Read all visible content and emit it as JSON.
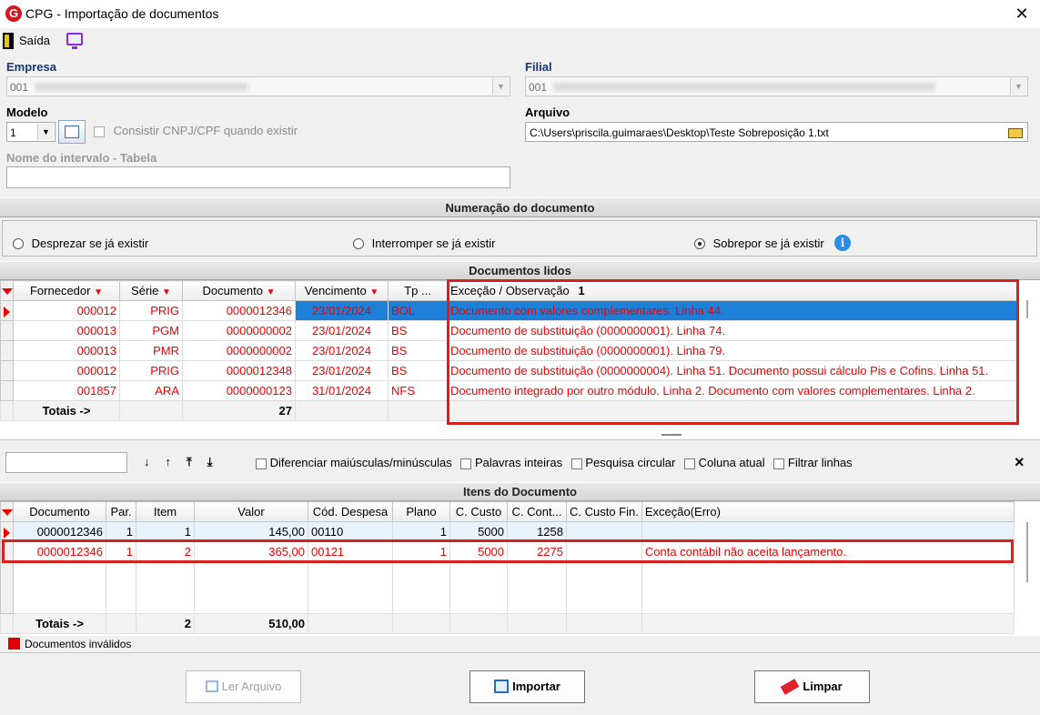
{
  "window": {
    "title": "CPG - Importação de documentos",
    "close": "✕"
  },
  "toolbar": {
    "exit_label": "Saída"
  },
  "empresa": {
    "label": "Empresa",
    "value": "001"
  },
  "filial": {
    "label": "Filial",
    "value": "001"
  },
  "modelo": {
    "label": "Modelo",
    "value": "1",
    "consistir_label": "Consistir CNPJ/CPF quando existir"
  },
  "arquivo": {
    "label": "Arquivo",
    "value": "C:\\Users\\priscila.guimaraes\\Desktop\\Teste Sobreposição 1.txt"
  },
  "intervalo": {
    "label": "Nome do intervalo - Tabela",
    "value": ""
  },
  "numeracao": {
    "title": "Numeração do documento",
    "options": [
      "Desprezar se já existir",
      "Interromper se já existir",
      "Sobrepor se já existir"
    ],
    "selected": "Sobrepor se já existir"
  },
  "docs": {
    "title": "Documentos lidos",
    "columns": [
      "Fornecedor",
      "Série",
      "Documento",
      "Vencimento",
      "Tp ...",
      "Exceção / Observação"
    ],
    "sort_badge": "1",
    "rows": [
      [
        "000012",
        "PRIG",
        "0000012346",
        "23/01/2024",
        "BOL",
        "Documento com valores complementares. Linha 44."
      ],
      [
        "000013",
        "PGM",
        "0000000002",
        "23/01/2024",
        "BS",
        "Documento de substituição (0000000001). Linha 74."
      ],
      [
        "000013",
        "PMR",
        "0000000002",
        "23/01/2024",
        "BS",
        "Documento de substituição (0000000001). Linha 79."
      ],
      [
        "000012",
        "PRIG",
        "0000012348",
        "23/01/2024",
        "BS",
        "Documento de substituição (0000000004). Linha 51. Documento possui cálculo Pis e Cofins. Linha 51."
      ],
      [
        "001857",
        "ARA",
        "0000000123",
        "31/01/2024",
        "NFS",
        "Documento integrado por outro módulo. Linha 2. Documento com valores complementares. Linha 2."
      ]
    ],
    "totals_label": "Totais ->",
    "totals_count": "27"
  },
  "search": {
    "value": "",
    "options": [
      "Diferenciar maiúsculas/minúsculas",
      "Palavras inteiras",
      "Pesquisa circular",
      "Coluna atual",
      "Filtrar linhas"
    ],
    "close": "×"
  },
  "itens": {
    "title": "Itens do Documento",
    "columns": [
      "Documento",
      "Par.",
      "Item",
      "Valor",
      "Cód. Despesa",
      "Plano",
      "C. Custo",
      "C. Cont...",
      "C. Custo Fin.",
      "Exceção(Erro)"
    ],
    "rows": [
      [
        "0000012346",
        "1",
        "1",
        "145,00",
        "00110",
        "1",
        "5000",
        "1258",
        "",
        ""
      ],
      [
        "0000012346",
        "1",
        "2",
        "365,00",
        "00121",
        "1",
        "5000",
        "2275",
        "",
        "Conta contábil não aceita lançamento."
      ]
    ],
    "totals_label": "Totais ->",
    "totals_items": "2",
    "totals_valor": "510,00"
  },
  "legend": {
    "label": "Documentos inválidos",
    "color": "#e00000"
  },
  "buttons": {
    "ler": "Ler Arquivo",
    "importar": "Importar",
    "limpar": "Limpar"
  },
  "colors": {
    "accent_red": "#d9201f",
    "selection": "#1e7fd8",
    "label_blue": "#17357a"
  }
}
